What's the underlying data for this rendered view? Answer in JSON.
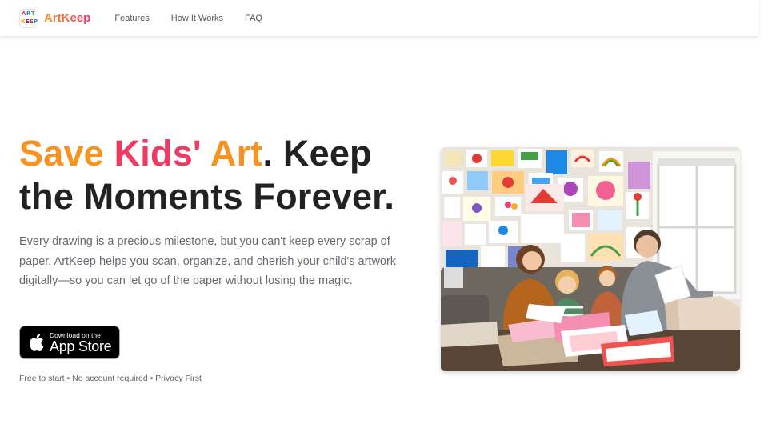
{
  "brand": {
    "name": "ArtKeep",
    "logo_letters": [
      "A",
      "R",
      "T",
      "K",
      "E",
      "E",
      "P"
    ],
    "gradient": [
      "#f7931e",
      "#f0306a"
    ]
  },
  "nav": {
    "items": [
      {
        "label": "Features"
      },
      {
        "label": "How It Works"
      },
      {
        "label": "FAQ"
      }
    ]
  },
  "hero": {
    "headline_part1": "Save",
    "headline_part2": "Kids'",
    "headline_part3": "Art",
    "headline_part4": ". Keep the Moments Forever.",
    "description": "Every drawing is a precious milestone, but you can't keep every scrap of paper. ArtKeep helps you scan, organize, and cherish your child's artwork digitally—so you can let go of the paper without losing the magic.",
    "appstore": {
      "small_label": "Download on the",
      "big_label": "App Store"
    },
    "footnote": "Free to start • No account required • Privacy First",
    "image_icon": "family-with-kids-artwork-photo"
  },
  "colors": {
    "accent_orange": "#f7931e",
    "accent_pink": "#ee3b63",
    "headline": "#222222",
    "body_text": "#666b73"
  }
}
